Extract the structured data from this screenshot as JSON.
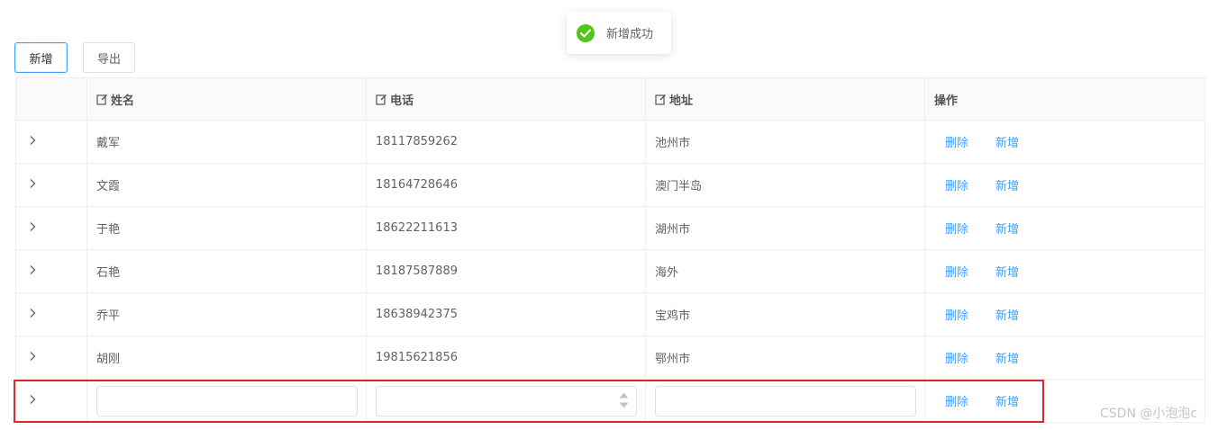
{
  "toolbar": {
    "add_label": "新增",
    "export_label": "导出"
  },
  "toast": {
    "message": "新增成功",
    "icon": "check-circle-icon",
    "color": "#52c41a"
  },
  "table": {
    "columns": [
      {
        "label": "",
        "key": "expand"
      },
      {
        "label": "姓名",
        "key": "name",
        "editable": true
      },
      {
        "label": "电话",
        "key": "phone",
        "editable": true
      },
      {
        "label": "地址",
        "key": "address",
        "editable": true
      },
      {
        "label": "操作",
        "key": "actions"
      }
    ],
    "rows": [
      {
        "name": "戴军",
        "phone": "18117859262",
        "address": "池州市"
      },
      {
        "name": "文霞",
        "phone": "18164728646",
        "address": "澳门半岛"
      },
      {
        "name": "于艳",
        "phone": "18622211613",
        "address": "湖州市"
      },
      {
        "name": "石艳",
        "phone": "18187587889",
        "address": "海外"
      },
      {
        "name": "乔平",
        "phone": "18638942375",
        "address": "宝鸡市"
      },
      {
        "name": "胡刚",
        "phone": "19815621856",
        "address": "鄂州市"
      }
    ],
    "new_row": {
      "name": "",
      "phone": "",
      "address": ""
    },
    "actions": {
      "delete_label": "删除",
      "add_label": "新增"
    }
  },
  "watermark": "CSDN @小泡泡c",
  "colors": {
    "link": "#409eff",
    "highlight_border": "#d42b2b"
  }
}
